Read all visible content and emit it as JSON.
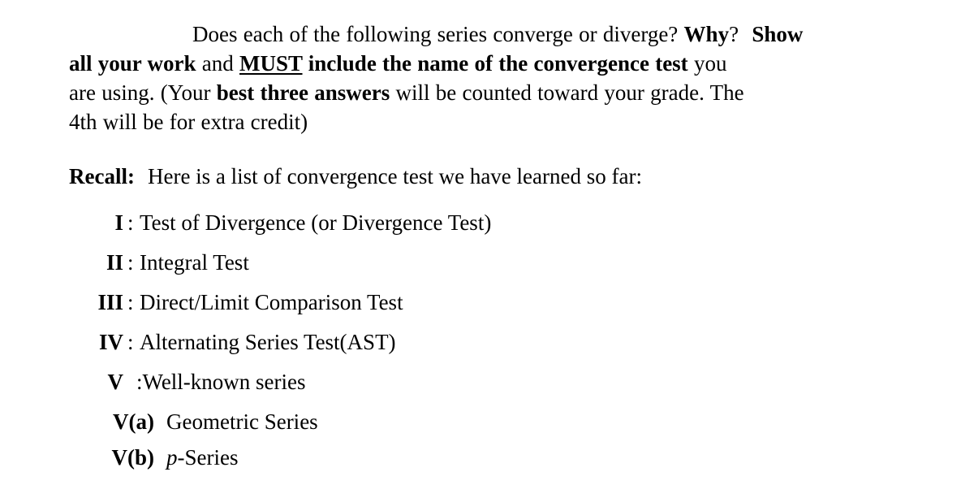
{
  "document": {
    "background_color": "#ffffff",
    "text_color": "#000000",
    "intro": {
      "line1_pre": "Does each of the following series converge or diverge? ",
      "line1_bold1": "Why",
      "line1_mid": "? ",
      "line1_bold2": "Show",
      "line2_bold1": "all your work",
      "line2_mid1": " and ",
      "line2_underline": "MUST",
      "line2_bold2": " include the name of the convergence test",
      "line2_tail": " you",
      "line3_pre": "are using. (Your ",
      "line3_bold": "best three answers",
      "line3_post": " will be counted toward your grade. The",
      "line4": "4th will be for extra credit)"
    },
    "recall": {
      "label": "Recall:",
      "text": "Here is a list of convergence test we have learned so far:"
    },
    "tests": [
      {
        "num": "I",
        "colon": ":",
        "label": "Test of Divergence (or Divergence Test)"
      },
      {
        "num": "II",
        "colon": ":",
        "label": "Integral Test"
      },
      {
        "num": "III",
        "colon": ":",
        "label": "Direct/Limit Comparison Test"
      },
      {
        "num": "IV",
        "colon": ":",
        "label": "Alternating Series Test(AST)"
      },
      {
        "num": "V",
        "colon": ":",
        "label": ":Well-known series"
      }
    ],
    "subtests": [
      {
        "num_main": "V",
        "num_sub": "(a)",
        "label": "Geometric Series",
        "italic_prefix": ""
      },
      {
        "num_main": "V",
        "num_sub": "(b)",
        "label": "-Series",
        "italic_prefix": "p"
      }
    ]
  }
}
